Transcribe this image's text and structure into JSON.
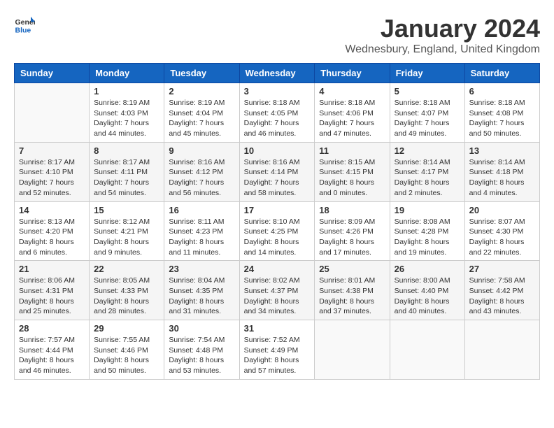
{
  "header": {
    "logo_general": "General",
    "logo_blue": "Blue",
    "title": "January 2024",
    "subtitle": "Wednesbury, England, United Kingdom"
  },
  "columns": [
    "Sunday",
    "Monday",
    "Tuesday",
    "Wednesday",
    "Thursday",
    "Friday",
    "Saturday"
  ],
  "weeks": [
    {
      "days": [
        {
          "num": "",
          "info": ""
        },
        {
          "num": "1",
          "info": "Sunrise: 8:19 AM\nSunset: 4:03 PM\nDaylight: 7 hours\nand 44 minutes."
        },
        {
          "num": "2",
          "info": "Sunrise: 8:19 AM\nSunset: 4:04 PM\nDaylight: 7 hours\nand 45 minutes."
        },
        {
          "num": "3",
          "info": "Sunrise: 8:18 AM\nSunset: 4:05 PM\nDaylight: 7 hours\nand 46 minutes."
        },
        {
          "num": "4",
          "info": "Sunrise: 8:18 AM\nSunset: 4:06 PM\nDaylight: 7 hours\nand 47 minutes."
        },
        {
          "num": "5",
          "info": "Sunrise: 8:18 AM\nSunset: 4:07 PM\nDaylight: 7 hours\nand 49 minutes."
        },
        {
          "num": "6",
          "info": "Sunrise: 8:18 AM\nSunset: 4:08 PM\nDaylight: 7 hours\nand 50 minutes."
        }
      ]
    },
    {
      "days": [
        {
          "num": "7",
          "info": "Sunrise: 8:17 AM\nSunset: 4:10 PM\nDaylight: 7 hours\nand 52 minutes."
        },
        {
          "num": "8",
          "info": "Sunrise: 8:17 AM\nSunset: 4:11 PM\nDaylight: 7 hours\nand 54 minutes."
        },
        {
          "num": "9",
          "info": "Sunrise: 8:16 AM\nSunset: 4:12 PM\nDaylight: 7 hours\nand 56 minutes."
        },
        {
          "num": "10",
          "info": "Sunrise: 8:16 AM\nSunset: 4:14 PM\nDaylight: 7 hours\nand 58 minutes."
        },
        {
          "num": "11",
          "info": "Sunrise: 8:15 AM\nSunset: 4:15 PM\nDaylight: 8 hours\nand 0 minutes."
        },
        {
          "num": "12",
          "info": "Sunrise: 8:14 AM\nSunset: 4:17 PM\nDaylight: 8 hours\nand 2 minutes."
        },
        {
          "num": "13",
          "info": "Sunrise: 8:14 AM\nSunset: 4:18 PM\nDaylight: 8 hours\nand 4 minutes."
        }
      ]
    },
    {
      "days": [
        {
          "num": "14",
          "info": "Sunrise: 8:13 AM\nSunset: 4:20 PM\nDaylight: 8 hours\nand 6 minutes."
        },
        {
          "num": "15",
          "info": "Sunrise: 8:12 AM\nSunset: 4:21 PM\nDaylight: 8 hours\nand 9 minutes."
        },
        {
          "num": "16",
          "info": "Sunrise: 8:11 AM\nSunset: 4:23 PM\nDaylight: 8 hours\nand 11 minutes."
        },
        {
          "num": "17",
          "info": "Sunrise: 8:10 AM\nSunset: 4:25 PM\nDaylight: 8 hours\nand 14 minutes."
        },
        {
          "num": "18",
          "info": "Sunrise: 8:09 AM\nSunset: 4:26 PM\nDaylight: 8 hours\nand 17 minutes."
        },
        {
          "num": "19",
          "info": "Sunrise: 8:08 AM\nSunset: 4:28 PM\nDaylight: 8 hours\nand 19 minutes."
        },
        {
          "num": "20",
          "info": "Sunrise: 8:07 AM\nSunset: 4:30 PM\nDaylight: 8 hours\nand 22 minutes."
        }
      ]
    },
    {
      "days": [
        {
          "num": "21",
          "info": "Sunrise: 8:06 AM\nSunset: 4:31 PM\nDaylight: 8 hours\nand 25 minutes."
        },
        {
          "num": "22",
          "info": "Sunrise: 8:05 AM\nSunset: 4:33 PM\nDaylight: 8 hours\nand 28 minutes."
        },
        {
          "num": "23",
          "info": "Sunrise: 8:04 AM\nSunset: 4:35 PM\nDaylight: 8 hours\nand 31 minutes."
        },
        {
          "num": "24",
          "info": "Sunrise: 8:02 AM\nSunset: 4:37 PM\nDaylight: 8 hours\nand 34 minutes."
        },
        {
          "num": "25",
          "info": "Sunrise: 8:01 AM\nSunset: 4:38 PM\nDaylight: 8 hours\nand 37 minutes."
        },
        {
          "num": "26",
          "info": "Sunrise: 8:00 AM\nSunset: 4:40 PM\nDaylight: 8 hours\nand 40 minutes."
        },
        {
          "num": "27",
          "info": "Sunrise: 7:58 AM\nSunset: 4:42 PM\nDaylight: 8 hours\nand 43 minutes."
        }
      ]
    },
    {
      "days": [
        {
          "num": "28",
          "info": "Sunrise: 7:57 AM\nSunset: 4:44 PM\nDaylight: 8 hours\nand 46 minutes."
        },
        {
          "num": "29",
          "info": "Sunrise: 7:55 AM\nSunset: 4:46 PM\nDaylight: 8 hours\nand 50 minutes."
        },
        {
          "num": "30",
          "info": "Sunrise: 7:54 AM\nSunset: 4:48 PM\nDaylight: 8 hours\nand 53 minutes."
        },
        {
          "num": "31",
          "info": "Sunrise: 7:52 AM\nSunset: 4:49 PM\nDaylight: 8 hours\nand 57 minutes."
        },
        {
          "num": "",
          "info": ""
        },
        {
          "num": "",
          "info": ""
        },
        {
          "num": "",
          "info": ""
        }
      ]
    }
  ]
}
